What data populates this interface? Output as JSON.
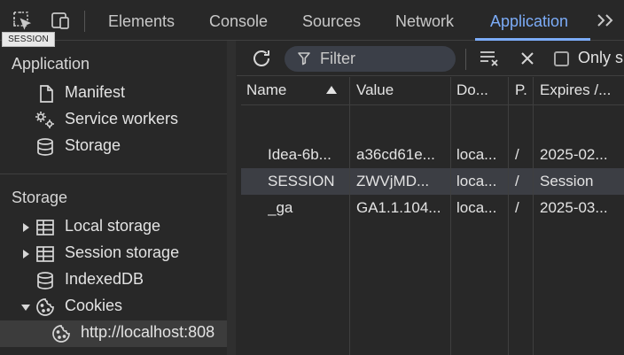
{
  "tooltip": "SESSION",
  "tabs": [
    {
      "label": "Elements"
    },
    {
      "label": "Console"
    },
    {
      "label": "Sources"
    },
    {
      "label": "Network"
    },
    {
      "label": "Application",
      "active": true
    }
  ],
  "sidebar": {
    "application_title": "Application",
    "application_items": [
      {
        "label": "Manifest",
        "icon": "file-icon"
      },
      {
        "label": "Service workers",
        "icon": "gears-icon"
      },
      {
        "label": "Storage",
        "icon": "database-icon"
      }
    ],
    "storage_title": "Storage",
    "storage_items": [
      {
        "label": "Local storage",
        "icon": "grid-icon",
        "expanded": false
      },
      {
        "label": "Session storage",
        "icon": "grid-icon",
        "expanded": false
      },
      {
        "label": "IndexedDB",
        "icon": "database-icon"
      },
      {
        "label": "Cookies",
        "icon": "cookie-icon",
        "expanded": true
      },
      {
        "label": "http://localhost:808",
        "icon": "cookie-icon",
        "selected": true
      }
    ]
  },
  "toolbar": {
    "filter_placeholder": "Filter",
    "only_label": "Only s"
  },
  "table": {
    "columns": [
      "Name",
      "Value",
      "Do...",
      "P.",
      "Expires /..."
    ],
    "sort": "ascending",
    "rows": [
      {
        "name": "Idea-6b...",
        "value": "a36cd61e...",
        "domain": "loca...",
        "path": "/",
        "expires": "2025-02...",
        "selected": false
      },
      {
        "name": "SESSION",
        "value": "ZWVjMD...",
        "domain": "loca...",
        "path": "/",
        "expires": "Session",
        "selected": true
      },
      {
        "name": "_ga",
        "value": "GA1.1.104...",
        "domain": "loca...",
        "path": "/",
        "expires": "2025-03...",
        "selected": false
      }
    ]
  },
  "colors": {
    "accent": "#7cacf8",
    "background": "#282828",
    "selected_row": "#3c3e44"
  }
}
